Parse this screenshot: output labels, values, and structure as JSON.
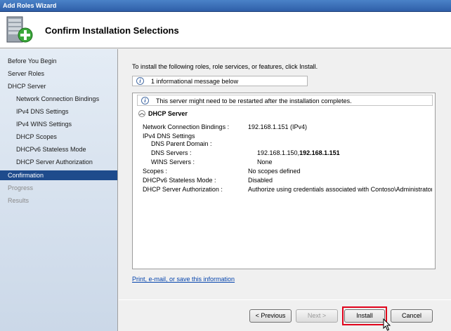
{
  "window": {
    "title": "Add Roles Wizard"
  },
  "header": {
    "title": "Confirm Installation Selections"
  },
  "sidebar": {
    "items": [
      {
        "label": "Before You Begin",
        "level": 0,
        "state": "normal"
      },
      {
        "label": "Server Roles",
        "level": 0,
        "state": "normal"
      },
      {
        "label": "DHCP Server",
        "level": 0,
        "state": "normal"
      },
      {
        "label": "Network Connection Bindings",
        "level": 1,
        "state": "normal"
      },
      {
        "label": "IPv4 DNS Settings",
        "level": 1,
        "state": "normal"
      },
      {
        "label": "IPv4 WINS Settings",
        "level": 1,
        "state": "normal"
      },
      {
        "label": "DHCP Scopes",
        "level": 1,
        "state": "normal"
      },
      {
        "label": "DHCPv6 Stateless Mode",
        "level": 1,
        "state": "normal"
      },
      {
        "label": "DHCP Server Authorization",
        "level": 1,
        "state": "normal"
      },
      {
        "label": "Confirmation",
        "level": 0,
        "state": "active"
      },
      {
        "label": "Progress",
        "level": 0,
        "state": "disabled"
      },
      {
        "label": "Results",
        "level": 0,
        "state": "disabled"
      }
    ]
  },
  "main": {
    "intro": "To install the following roles, role services, or features, click Install.",
    "info_message": "1 informational message below",
    "restart_notice": "This server might need to be restarted after the installation completes.",
    "section_title": "DHCP Server",
    "details": {
      "bindings_label": "Network Connection Bindings :",
      "bindings_value": "192.168.1.151 (IPv4)",
      "ipv4dns_label": "IPv4 DNS Settings",
      "dns_parent_label": "DNS Parent Domain :",
      "dns_servers_label": "DNS Servers :",
      "dns_servers_value_a": "192.168.1.150,",
      "dns_servers_value_b": "192.168.1.151",
      "wins_label": "WINS Servers :",
      "wins_value": "None",
      "scopes_label": "Scopes :",
      "scopes_value": "No scopes defined",
      "dhcpv6_label": "DHCPv6 Stateless Mode :",
      "dhcpv6_value": "Disabled",
      "auth_label": "DHCP Server Authorization :",
      "auth_value": "Authorize using credentials associated with Contoso\\Administrator"
    },
    "print_link": "Print, e-mail, or save this information"
  },
  "footer": {
    "previous_label": "< Previous",
    "next_label": "Next >",
    "install_label": "Install",
    "cancel_label": "Cancel"
  },
  "colors": {
    "active_nav": "#1e4b8c",
    "highlight": "#e0001a",
    "link": "#0645ad"
  }
}
